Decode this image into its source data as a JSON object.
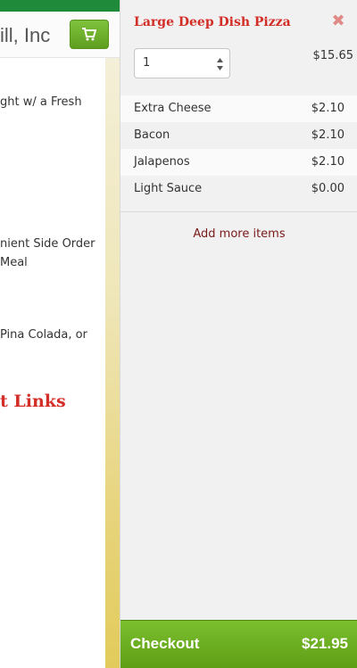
{
  "background": {
    "brand_text": "ill, Inc",
    "lines": [
      "ght w/ a Fresh",
      "nient Side Order",
      "Meal",
      "Pina Colada, or"
    ],
    "heading": "t Links",
    "cart_icon": "cart-icon"
  },
  "cart": {
    "item_title": "Large Deep Dish Pizza",
    "close_icon": "close-icon",
    "quantity": "1",
    "base_price": "$15.65",
    "options": [
      {
        "name": "Extra Cheese",
        "price": "$2.10"
      },
      {
        "name": "Bacon",
        "price": "$2.10"
      },
      {
        "name": "Jalapenos",
        "price": "$2.10"
      },
      {
        "name": "Light Sauce",
        "price": "$0.00"
      }
    ],
    "add_more_label": "Add more items",
    "checkout_label": "Checkout",
    "total": "$21.95"
  },
  "colors": {
    "title_red": "#d32d27",
    "checkout_green": "#6aad22",
    "link_maroon": "#7a1a1a"
  }
}
